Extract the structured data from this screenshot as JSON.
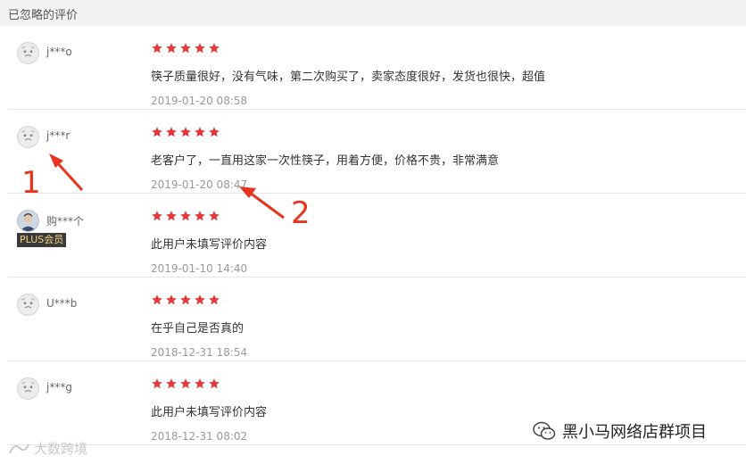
{
  "header": {
    "title": "已忽略的评价"
  },
  "reviews": [
    {
      "user": "j***o",
      "stars": 5,
      "avatar": "default-avatar",
      "content": "筷子质量很好，没有气味，第二次购买了，卖家态度很好，发货也很快，超值",
      "date": "2019-01-20 08:58"
    },
    {
      "user": "j***r",
      "stars": 5,
      "avatar": "default-avatar",
      "content": "老客户了，一直用这家一次性筷子，用着方便，价格不贵，非常满意",
      "date": "2019-01-20 08:47"
    },
    {
      "user": "购***个",
      "stars": 5,
      "avatar": "photo-avatar",
      "badge": "PLUS会员",
      "content": "此用户未填写评价内容",
      "date": "2019-01-10 14:40"
    },
    {
      "user": "U***b",
      "stars": 5,
      "avatar": "default-avatar",
      "content": "在乎自己是否真的",
      "date": "2018-12-31 18:54"
    },
    {
      "user": "j***g",
      "stars": 5,
      "avatar": "default-avatar",
      "content": "此用户未填写评价内容",
      "date": "2018-12-31 08:02"
    }
  ],
  "annotations": {
    "marker1": "1",
    "marker2": "2",
    "color": "#e8331f"
  },
  "star_color": "#e4393c",
  "watermarks": {
    "left": "大数跨境",
    "right": "黑小马网络店群项目"
  }
}
